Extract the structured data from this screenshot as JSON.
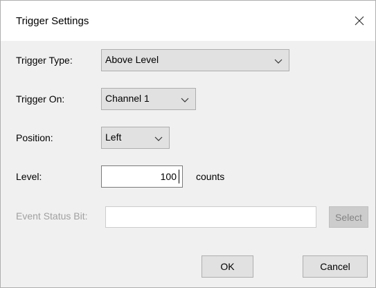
{
  "window": {
    "title": "Trigger Settings",
    "close_icon": "close-icon"
  },
  "form": {
    "trigger_type": {
      "label": "Trigger Type:",
      "value": "Above Level"
    },
    "trigger_on": {
      "label": "Trigger On:",
      "value": "Channel 1"
    },
    "position": {
      "label": "Position:",
      "value": "Left"
    },
    "level": {
      "label": "Level:",
      "value": "100",
      "units": "counts"
    },
    "event_status_bit": {
      "label": "Event Status Bit:",
      "value": "",
      "select_label": "Select"
    }
  },
  "buttons": {
    "ok_label": "OK",
    "cancel_label": "Cancel"
  },
  "colors": {
    "titlebar": "#ffffff",
    "dialog_bg": "#f0f0f0",
    "disabled_text": "#a0a0a0"
  }
}
